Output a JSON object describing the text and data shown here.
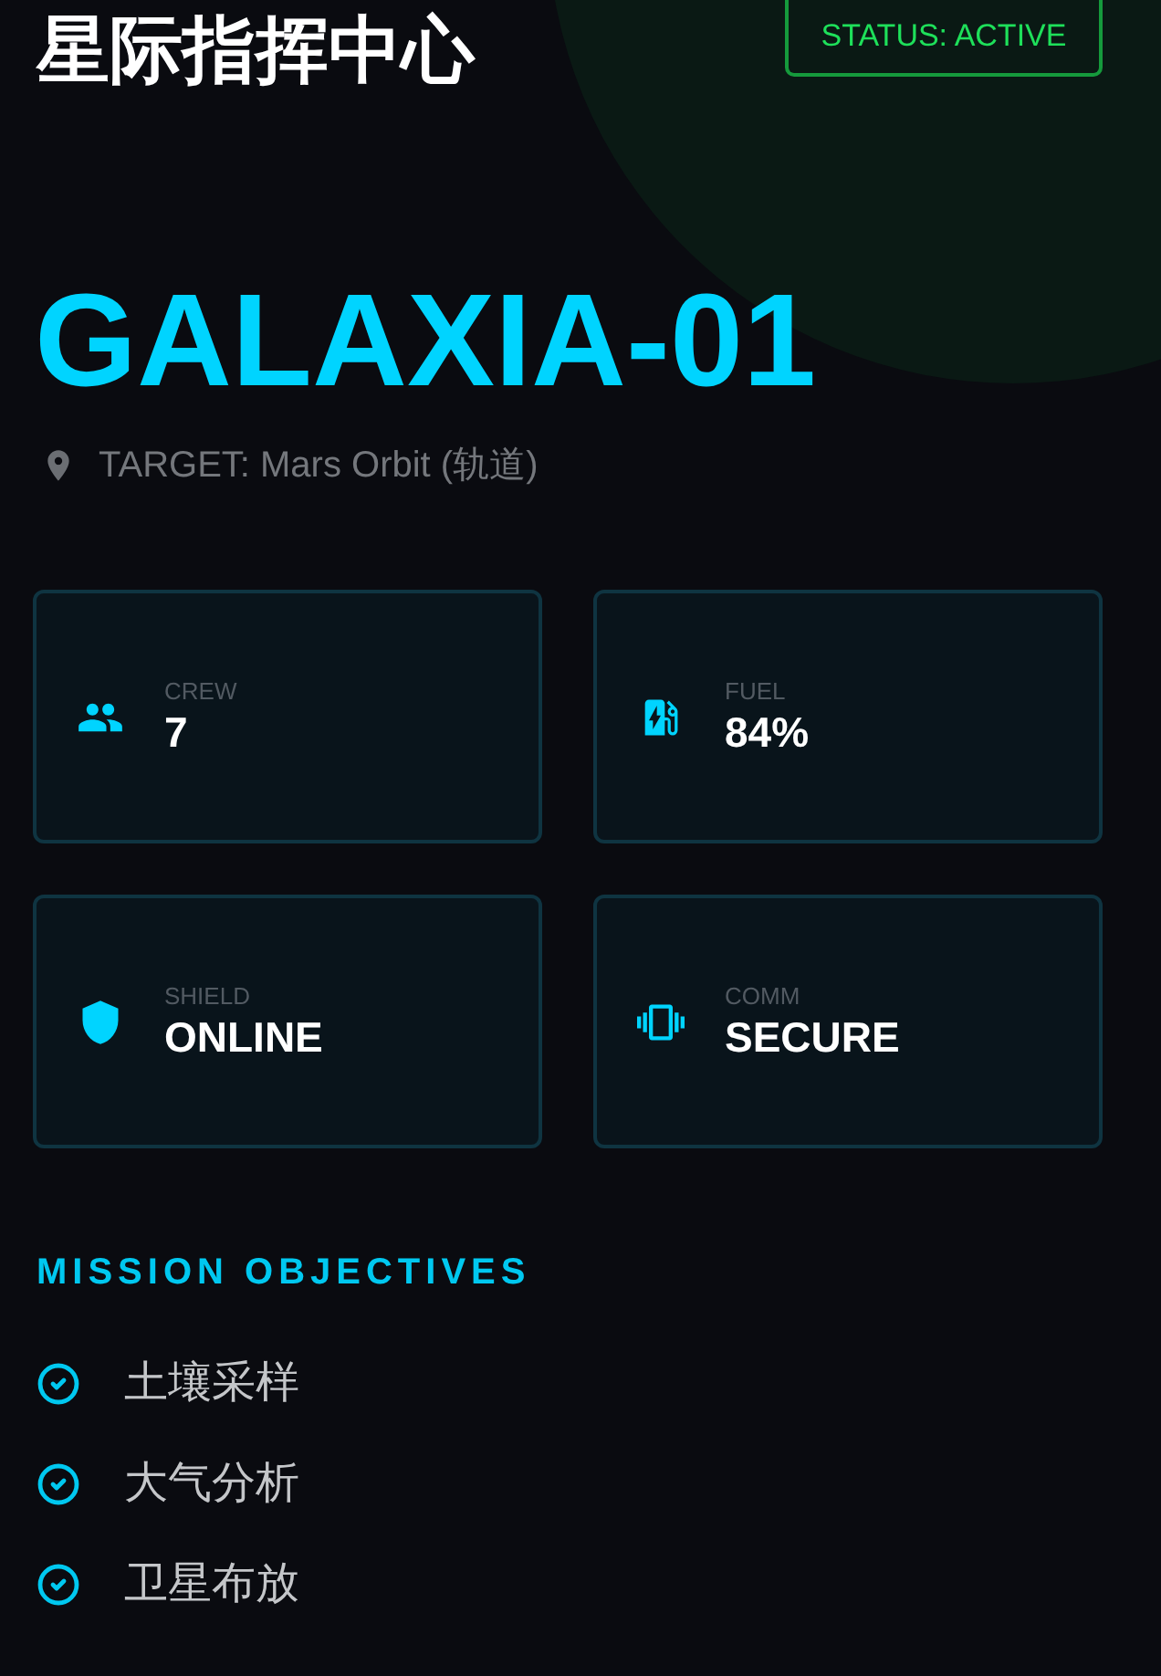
{
  "header": {
    "title": "星际指挥中心",
    "status": "STATUS: ACTIVE"
  },
  "ship": {
    "name": "GALAXIA-01",
    "target": "TARGET: Mars Orbit (轨道)"
  },
  "stats": [
    {
      "kind": "crew",
      "label": "CREW",
      "value": "7"
    },
    {
      "kind": "fuel",
      "label": "FUEL",
      "value": "84%"
    },
    {
      "kind": "shield",
      "label": "SHIELD",
      "value": "ONLINE"
    },
    {
      "kind": "comm",
      "label": "COMM",
      "value": "SECURE"
    }
  ],
  "objectives": {
    "heading": "MISSION OBJECTIVES",
    "items": [
      {
        "text": "土壤采样",
        "checked": true
      },
      {
        "text": "大气分析",
        "checked": true
      },
      {
        "text": "卫星布放",
        "checked": true
      }
    ]
  }
}
